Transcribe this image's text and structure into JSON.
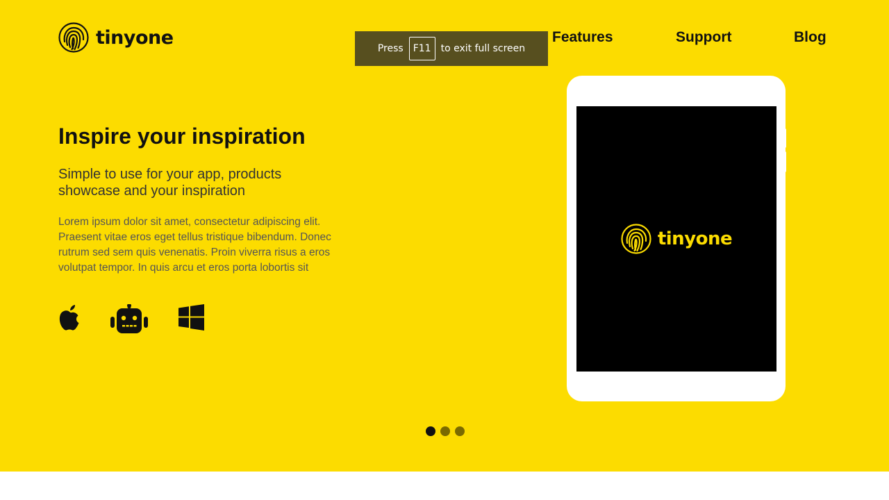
{
  "brand": {
    "name": "tinyone",
    "logo_icon": "fingerprint-icon"
  },
  "nav": {
    "items": [
      {
        "label": "Features"
      },
      {
        "label": "Support"
      },
      {
        "label": "Blog"
      }
    ]
  },
  "fullscreen_notice": {
    "prefix": "Press",
    "key": "F11",
    "suffix": "to exit full screen"
  },
  "hero": {
    "title": "Inspire your inspiration",
    "subtitle": "Simple to use for your app, products showcase and your inspiration",
    "body": "Lorem ipsum dolor sit amet, consectetur adipiscing elit. Praesent vitae eros eget tellus tristique bibendum. Donec rutrum sed sem quis venenatis. Proin viverra risus a eros volutpat tempor. In quis arcu et eros porta lobortis sit",
    "platforms": [
      "apple-icon",
      "android-robot-icon",
      "windows-icon"
    ]
  },
  "device": {
    "screen_brand": "tinyone"
  },
  "carousel": {
    "slide_count": 3,
    "active_index": 0
  },
  "colors": {
    "accent": "#fcdc00",
    "text": "#111111",
    "dot_active": "#111111",
    "dot_inactive": "#7a6a00"
  }
}
